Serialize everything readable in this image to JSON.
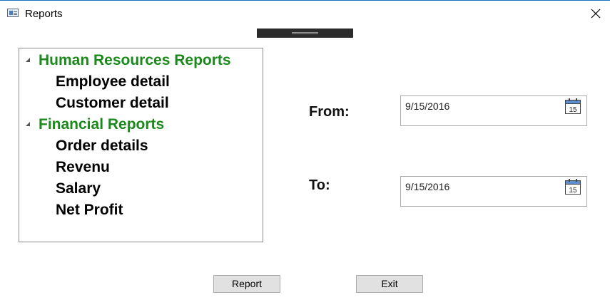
{
  "window": {
    "title": "Reports",
    "icon": "window-app-icon",
    "close_icon": "close-icon"
  },
  "tree": {
    "groups": [
      {
        "label": "Human Resources Reports",
        "expanded": true,
        "color": "#1a8a1a",
        "items": [
          "Employee detail",
          "Customer detail"
        ]
      },
      {
        "label": "Financial Reports",
        "expanded": true,
        "color": "#1a8a1a",
        "items": [
          "Order details",
          "Revenu",
          "Salary",
          "Net Profit"
        ]
      }
    ]
  },
  "form": {
    "from_label": "From:",
    "from_value": "9/15/2016",
    "to_label": "To:",
    "to_value": "9/15/2016",
    "calendar_icon_day": "15"
  },
  "buttons": {
    "report": "Report",
    "exit": "Exit"
  },
  "colors": {
    "group_text": "#1a8a1a",
    "window_border": "#1e6fbf"
  }
}
